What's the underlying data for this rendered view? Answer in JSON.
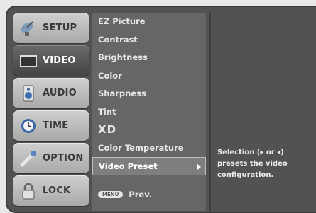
{
  "nav": [
    {
      "label": "SETUP",
      "icon": "satellite-dish-icon",
      "active": false
    },
    {
      "label": "VIDEO",
      "icon": "monitor-icon",
      "active": true
    },
    {
      "label": "AUDIO",
      "icon": "speaker-icon",
      "active": false
    },
    {
      "label": "TIME",
      "icon": "clock-icon",
      "active": false
    },
    {
      "label": "OPTION",
      "icon": "wrench-icon",
      "active": false
    },
    {
      "label": "LOCK",
      "icon": "padlock-icon",
      "active": false
    }
  ],
  "menu": {
    "items": [
      "EZ Picture",
      "Contrast",
      "Brightness",
      "Color",
      "Sharpness",
      "Tint",
      "XD",
      "Color Temperature",
      "Video Preset"
    ],
    "selected_index": 8,
    "prev_badge": "MENU",
    "prev_label": "Prev."
  },
  "help": {
    "line1": "Selection (▸ or ◂)",
    "line2": "presets the video",
    "line3": "configuration."
  },
  "colors": {
    "screen": "#525252",
    "menu": "#666666",
    "selected": "#7e7e7e",
    "nav_active": "#555555"
  }
}
